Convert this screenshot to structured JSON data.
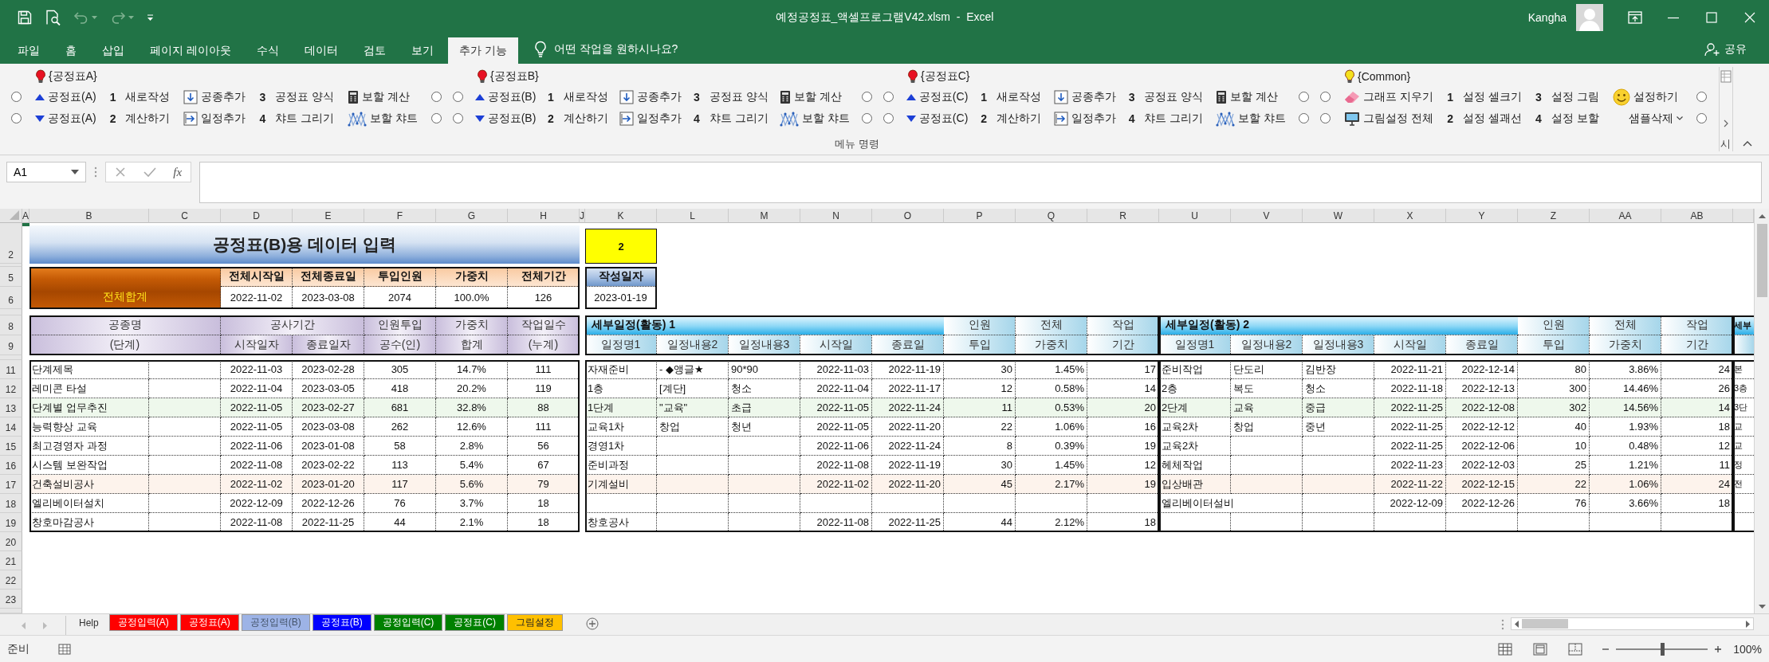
{
  "window": {
    "title": "예정공정표_액셀프로그램V42.xlsm  -  Excel",
    "user": "Kangha"
  },
  "ribbon_tabs": [
    {
      "label": "파일",
      "selected": false
    },
    {
      "label": "홈",
      "selected": false
    },
    {
      "label": "삽입",
      "selected": false
    },
    {
      "label": "페이지 레이아웃",
      "selected": false
    },
    {
      "label": "수식",
      "selected": false
    },
    {
      "label": "데이터",
      "selected": false
    },
    {
      "label": "검토",
      "selected": false
    },
    {
      "label": "보기",
      "selected": false
    },
    {
      "label": "추가 기능",
      "selected": true
    }
  ],
  "tell_me": "어떤 작업을 원하시나요?",
  "share": "공유",
  "ribbon": {
    "groups": [
      {
        "title": "{공정표A}",
        "color": "#e81123",
        "rows": [
          [
            {
              "kind": "radio",
              "selected": false
            },
            {
              "kind": "up",
              "label": "공정표(A)"
            },
            {
              "kind": "numbered",
              "number": "1",
              "label": "새로작성"
            },
            {
              "kind": "insert",
              "label": "공종추가"
            },
            {
              "kind": "numbered",
              "number": "3",
              "label": "공정표 양식"
            },
            {
              "kind": "calc",
              "label": "보할 계산"
            },
            {
              "kind": "radio",
              "selected": false
            }
          ],
          [
            {
              "kind": "radio",
              "selected": false
            },
            {
              "kind": "down",
              "label": "공정표(A)"
            },
            {
              "kind": "numbered",
              "number": "2",
              "label": "계산하기"
            },
            {
              "kind": "append",
              "label": "일정추가"
            },
            {
              "kind": "numbered",
              "number": "4",
              "label": "챠트 그리기"
            },
            {
              "kind": "chart",
              "label": "보할 챠트"
            },
            {
              "kind": "radio",
              "selected": false
            }
          ]
        ]
      },
      {
        "title": "{공정표B}",
        "color": "#e81123",
        "rows": [
          [
            {
              "kind": "radio",
              "selected": false
            },
            {
              "kind": "up",
              "label": "공정표(B)"
            },
            {
              "kind": "numbered",
              "number": "1",
              "label": "새로작성"
            },
            {
              "kind": "insert",
              "label": "공종추가"
            },
            {
              "kind": "numbered",
              "number": "3",
              "label": "공정표 양식"
            },
            {
              "kind": "calc",
              "label": "보할 계산"
            },
            {
              "kind": "radio",
              "selected": false
            }
          ],
          [
            {
              "kind": "radio",
              "selected": false
            },
            {
              "kind": "down",
              "label": "공정표(B)"
            },
            {
              "kind": "numbered",
              "number": "2",
              "label": "계산하기"
            },
            {
              "kind": "append",
              "label": "일정추가"
            },
            {
              "kind": "numbered",
              "number": "4",
              "label": "챠트 그리기"
            },
            {
              "kind": "chart",
              "label": "보할 챠트"
            },
            {
              "kind": "radio",
              "selected": false
            }
          ]
        ]
      },
      {
        "title": "{공정표C}",
        "color": "#e81123",
        "rows": [
          [
            {
              "kind": "radio",
              "selected": false
            },
            {
              "kind": "up",
              "label": "공정표(C)"
            },
            {
              "kind": "numbered",
              "number": "1",
              "label": "새로작성"
            },
            {
              "kind": "insert",
              "label": "공종추가"
            },
            {
              "kind": "numbered",
              "number": "3",
              "label": "공정표 양식"
            },
            {
              "kind": "calc",
              "label": "보할 계산"
            },
            {
              "kind": "radio",
              "selected": false
            }
          ],
          [
            {
              "kind": "radio",
              "selected": false
            },
            {
              "kind": "down",
              "label": "공정표(C)"
            },
            {
              "kind": "numbered",
              "number": "2",
              "label": "계산하기"
            },
            {
              "kind": "append",
              "label": "일정추가"
            },
            {
              "kind": "numbered",
              "number": "4",
              "label": "챠트 그리기"
            },
            {
              "kind": "chart",
              "label": "보할 챠트"
            },
            {
              "kind": "radio",
              "selected": false
            }
          ]
        ]
      },
      {
        "title": "{Common}",
        "color": "#f5e11e",
        "rows": [
          [
            {
              "kind": "radio",
              "selected": false
            },
            {
              "kind": "eraser",
              "label": "그래프 지우기"
            },
            {
              "kind": "numbered",
              "number": "1",
              "label": "설정 셀크기"
            },
            {
              "kind": "numbered",
              "number": "3",
              "label": "설정 그림"
            },
            {
              "kind": "smiley",
              "label": "설정하기"
            },
            {
              "kind": "radio",
              "selected": false
            }
          ],
          [
            {
              "kind": "radio",
              "selected": false
            },
            {
              "kind": "monitor",
              "label": "그림설정 전체"
            },
            {
              "kind": "numbered",
              "number": "2",
              "label": "설정 셀괘선"
            },
            {
              "kind": "numbered",
              "number": "4",
              "label": "설정 보할"
            },
            {
              "kind": "menu",
              "label": "샘플삭제"
            },
            {
              "kind": "radio",
              "selected": false
            }
          ]
        ]
      }
    ],
    "caption": "메뉴 명령",
    "overflow_label": "시"
  },
  "formula_bar": {
    "name_box": "A1",
    "function_label": "fx"
  },
  "sheet": {
    "columns": [
      "A",
      "B",
      "C",
      "D",
      "E",
      "F",
      "G",
      "H",
      "J",
      "K",
      "L",
      "M",
      "N",
      "O",
      "P",
      "Q",
      "R",
      "U",
      "V",
      "W",
      "X",
      "Y",
      "Z",
      "AA",
      "AB"
    ],
    "row_numbers": [
      "2",
      "5",
      "6",
      "8",
      "9",
      "11",
      "12",
      "13",
      "14",
      "15",
      "16",
      "17",
      "18",
      "19",
      "20",
      "21",
      "22",
      "23"
    ],
    "title": "공정표(B)용 데이터 입력",
    "sheet_number": "2",
    "summary": {
      "label": "전체합계",
      "columns": [
        {
          "header": "전체시작일",
          "value": "2022-11-02"
        },
        {
          "header": "전체종료일",
          "value": "2023-03-08"
        },
        {
          "header": "투입인원",
          "value": "2074"
        },
        {
          "header": "가중치",
          "value": "100.0%"
        },
        {
          "header": "전체기간",
          "value": "126"
        }
      ]
    },
    "created": {
      "header": "작성일자",
      "value": "2023-01-19"
    },
    "main_table": {
      "header": {
        "name": [
          "공종명",
          "(단계)"
        ],
        "period": "공사기간",
        "start": "시작일자",
        "end": "종료일자",
        "others": [
          [
            "인원투입",
            "공수(인)"
          ],
          [
            "가중치",
            "합계"
          ],
          [
            "작업일수",
            "(누계)"
          ]
        ]
      },
      "rows": [
        {
          "cells": [
            "단계제목",
            null,
            "2022-11-03",
            "2023-02-28",
            "305",
            "14.7%",
            "111"
          ]
        },
        {
          "cells": [
            "레미콘 타설",
            null,
            "2022-11-04",
            "2023-03-05",
            "418",
            "20.2%",
            "119"
          ]
        },
        {
          "cells": [
            "단계별 업무추진",
            null,
            "2022-11-05",
            "2023-02-27",
            "681",
            "32.8%",
            "88"
          ],
          "color": "#eef8ec"
        },
        {
          "cells": [
            "능력향상 교육",
            null,
            "2022-11-05",
            "2023-03-08",
            "262",
            "12.6%",
            "111"
          ]
        },
        {
          "cells": [
            "최고경영자 과정",
            null,
            "2022-11-06",
            "2023-01-08",
            "58",
            "2.8%",
            "56"
          ]
        },
        {
          "cells": [
            "시스템 보완작업",
            null,
            "2022-11-08",
            "2023-02-22",
            "113",
            "5.4%",
            "67"
          ]
        },
        {
          "cells": [
            "건축설비공사",
            null,
            "2022-11-02",
            "2023-01-20",
            "117",
            "5.6%",
            "79"
          ],
          "color": "#fdf3ec"
        },
        {
          "cells": [
            "엘리베이터설치",
            null,
            "2022-12-09",
            "2022-12-26",
            "76",
            "3.7%",
            "18"
          ]
        },
        {
          "cells": [
            "창호마감공사",
            null,
            "2022-11-08",
            "2022-11-25",
            "44",
            "2.1%",
            "18"
          ]
        }
      ]
    },
    "schedules": [
      {
        "title": "세부일정(활동) 1",
        "columns": [
          "일정명1",
          "일정내용2",
          "일정내용3",
          "시작일",
          "종료일"
        ],
        "extra_columns": [
          [
            "인원",
            "투입"
          ],
          [
            "전체",
            "가중치"
          ],
          [
            "작업",
            "기간"
          ]
        ],
        "rows": [
          {
            "cells": [
              "자재준비",
              "- ◆앵글★",
              "90*90",
              "2022-11-03",
              "2022-11-19",
              "30",
              "1.45%",
              "17"
            ]
          },
          {
            "cells": [
              "1층",
              "[계단]",
              "청소",
              "2022-11-04",
              "2022-11-17",
              "12",
              "0.58%",
              "14"
            ]
          },
          {
            "cells": [
              "1단계",
              "\"교육\"",
              "초급",
              "2022-11-05",
              "2022-11-24",
              "11",
              "0.53%",
              "20"
            ],
            "color": "#eef8ec"
          },
          {
            "cells": [
              "교육1차",
              "창업",
              "청년",
              "2022-11-05",
              "2022-11-20",
              "22",
              "1.06%",
              "16"
            ]
          },
          {
            "cells": [
              "경영1차",
              null,
              null,
              "2022-11-06",
              "2022-11-24",
              "8",
              "0.39%",
              "19"
            ]
          },
          {
            "cells": [
              "준비과정",
              null,
              null,
              "2022-11-08",
              "2022-11-19",
              "30",
              "1.45%",
              "12"
            ]
          },
          {
            "cells": [
              "기계설비",
              null,
              null,
              "2022-11-02",
              "2022-11-20",
              "45",
              "2.17%",
              "19"
            ],
            "color": "#fdf3ec"
          },
          {},
          {
            "cells": [
              "창호공사",
              null,
              null,
              "2022-11-08",
              "2022-11-25",
              "44",
              "2.12%",
              "18"
            ]
          }
        ]
      },
      {
        "title": "세부일정(활동) 2",
        "columns": [
          "일정명1",
          "일정내용2",
          "일정내용3",
          "시작일",
          "종료일"
        ],
        "extra_columns": [
          [
            "인원",
            "투입"
          ],
          [
            "전체",
            "가중치"
          ],
          [
            "작업",
            "기간"
          ]
        ],
        "rows": [
          {
            "cells": [
              "준비작업",
              "단도리",
              "김반장",
              "2022-11-21",
              "2022-12-14",
              "80",
              "3.86%",
              "24"
            ]
          },
          {
            "cells": [
              "2층",
              "복도",
              "청소",
              "2022-11-18",
              "2022-12-13",
              "300",
              "14.46%",
              "26"
            ]
          },
          {
            "cells": [
              "2단계",
              "교육",
              "중급",
              "2022-11-25",
              "2022-12-08",
              "302",
              "14.56%",
              "14"
            ],
            "color": "#eef8ec"
          },
          {
            "cells": [
              "교육2차",
              "창업",
              "중년",
              "2022-11-25",
              "2022-12-12",
              "40",
              "1.93%",
              "18"
            ]
          },
          {
            "cells": [
              "교육2차",
              null,
              null,
              "2022-11-25",
              "2022-12-06",
              "10",
              "0.48%",
              "12"
            ]
          },
          {
            "cells": [
              "헤체작업",
              null,
              null,
              "2022-11-23",
              "2022-12-03",
              "25",
              "1.21%",
              "11"
            ]
          },
          {
            "cells": [
              "입상배관",
              null,
              null,
              "2022-11-22",
              "2022-12-15",
              "22",
              "1.06%",
              "24"
            ],
            "color": "#fdf3ec"
          },
          {
            "cells": [
              "엘리베이터설비",
              null,
              null,
              "2022-12-09",
              "2022-12-26",
              "76",
              "3.66%",
              "18"
            ]
          },
          {}
        ]
      }
    ],
    "partial_schedule": {
      "title": "세부",
      "rows": [
        "본",
        "3층",
        "3단",
        "교",
        "교",
        "정",
        "전"
      ]
    }
  },
  "sheet_tabs": [
    {
      "label": "Help",
      "selected": false
    },
    {
      "label": "공정입력(A)",
      "color": "#ff0000",
      "selected": false
    },
    {
      "label": "공정표(A)",
      "color": "#ff0000",
      "selected": false
    },
    {
      "label": "공정입력(B)",
      "color": "#9db3e6",
      "selected": true
    },
    {
      "label": "공정표(B)",
      "color": "#0000ff",
      "selected": false
    },
    {
      "label": "공정입력(C)",
      "color": "#008000",
      "selected": false
    },
    {
      "label": "공정표(C)",
      "color": "#008000",
      "selected": false
    },
    {
      "label": "그림설정",
      "color": "#ffc000",
      "selected": false
    }
  ],
  "status": {
    "text": "준비",
    "zoom": {
      "level": 0.5,
      "reading": "100%"
    }
  }
}
